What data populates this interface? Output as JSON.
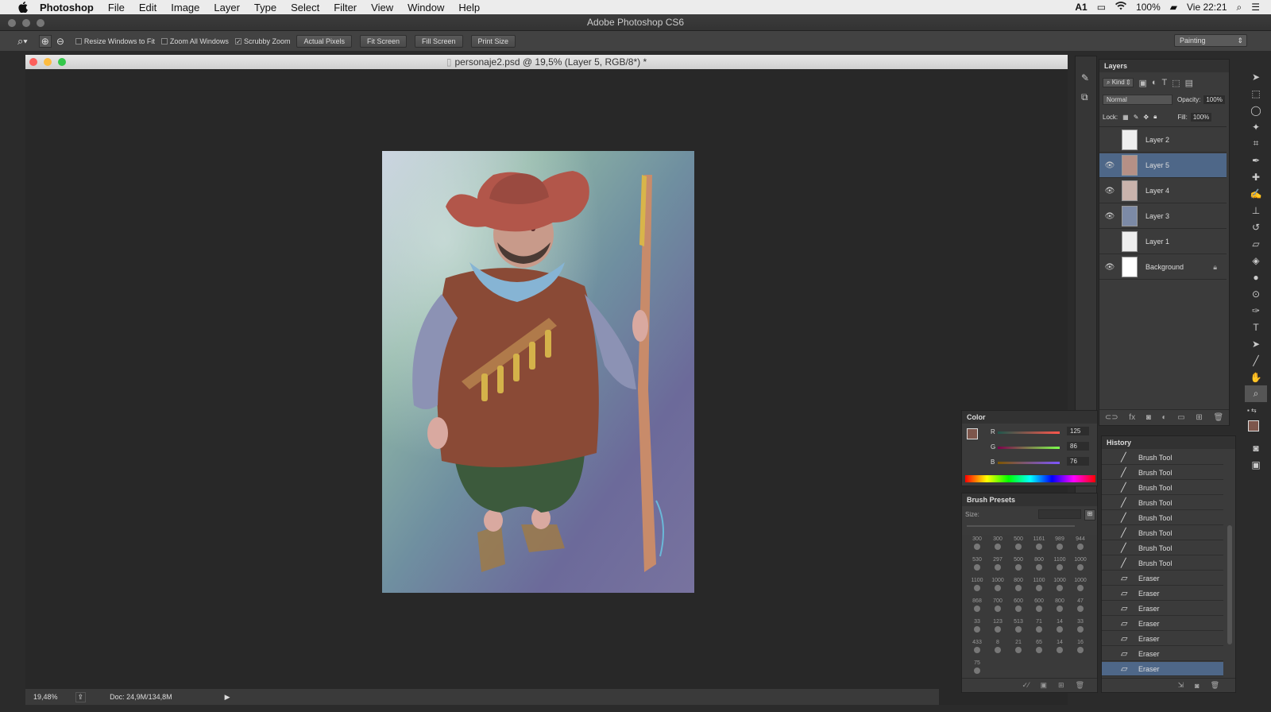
{
  "menubar": {
    "app_name": "Photoshop",
    "items": [
      "File",
      "Edit",
      "Image",
      "Layer",
      "Type",
      "Select",
      "Filter",
      "View",
      "Window",
      "Help"
    ],
    "status": {
      "ai_indicator": "1",
      "battery": "100%",
      "clock": "Vie 22:21"
    }
  },
  "window": {
    "title": "Adobe Photoshop CS6"
  },
  "options_bar": {
    "resize_windows": "Resize Windows to Fit",
    "zoom_all": "Zoom All Windows",
    "scrubby_zoom": "Scrubby Zoom",
    "actual_pixels": "Actual Pixels",
    "fit_screen": "Fit Screen",
    "fill_screen": "Fill Screen",
    "print_size": "Print Size",
    "workspace": "Painting"
  },
  "document": {
    "title": "personaje2.psd @ 19,5% (Layer 5, RGB/8*) *",
    "zoom": "19,48%",
    "doc_size": "Doc: 24,9M/134,8M"
  },
  "layers_panel": {
    "title": "Layers",
    "filter_kind": "Kind",
    "blend_mode": "Normal",
    "opacity_label": "Opacity:",
    "opacity_value": "100%",
    "lock_label": "Lock:",
    "fill_label": "Fill:",
    "fill_value": "100%",
    "layers": [
      {
        "name": "Layer 2",
        "visible": false,
        "selected": false
      },
      {
        "name": "Layer 5",
        "visible": true,
        "selected": true
      },
      {
        "name": "Layer 4",
        "visible": true,
        "selected": false
      },
      {
        "name": "Layer 3",
        "visible": true,
        "selected": false
      },
      {
        "name": "Layer 1",
        "visible": false,
        "selected": false
      },
      {
        "name": "Background",
        "visible": true,
        "selected": false,
        "locked": true
      }
    ]
  },
  "color_panel": {
    "title": "Color",
    "r_label": "R",
    "r_value": "125",
    "g_label": "G",
    "g_value": "86",
    "b_label": "B",
    "b_value": "76",
    "foreground_color": "#7d564c"
  },
  "brush_presets": {
    "title": "Brush Presets",
    "size_label": "Size:",
    "sizes": [
      "300",
      "300",
      "500",
      "1161",
      "989",
      "944",
      "530",
      "297",
      "500",
      "800",
      "1100",
      "1000",
      "1100",
      "1000",
      "800",
      "1100",
      "1000",
      "1000",
      "868",
      "700",
      "600",
      "600",
      "800",
      "47",
      "33",
      "123",
      "513",
      "71",
      "14",
      "33",
      "433",
      "8",
      "21",
      "65",
      "14",
      "16",
      "75"
    ]
  },
  "history_panel": {
    "title": "History",
    "items": [
      "Brush Tool",
      "Brush Tool",
      "Brush Tool",
      "Brush Tool",
      "Brush Tool",
      "Brush Tool",
      "Brush Tool",
      "Brush Tool",
      "Eraser",
      "Eraser",
      "Eraser",
      "Eraser",
      "Eraser",
      "Eraser",
      "Eraser"
    ],
    "selected_index": 14
  },
  "colors": {
    "selection": "#4e6788",
    "panel_bg": "#3b3b3b"
  }
}
